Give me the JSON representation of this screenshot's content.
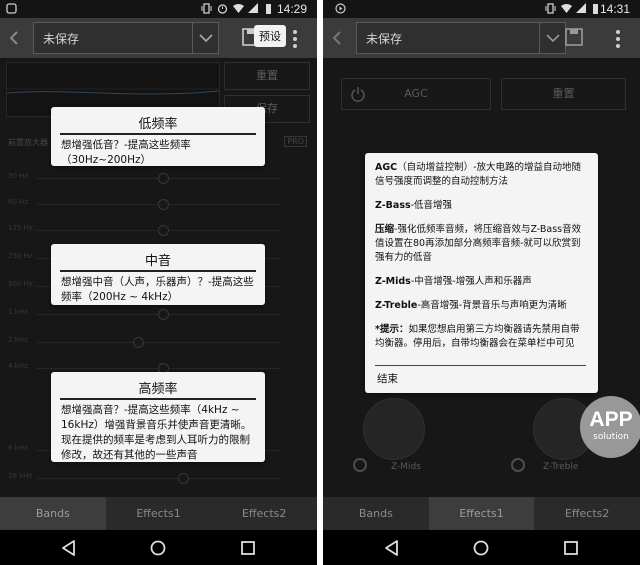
{
  "left": {
    "status_time": "14:29",
    "preset_value": "未保存",
    "tooltip": "预设",
    "buttons": {
      "reset": "重置",
      "save": "保存"
    },
    "mini_label": "前置放大器",
    "pro_tag": "PRO",
    "band_labels": [
      "30 Hz",
      "60 Hz",
      "125 Hz",
      "250 Hz",
      "500 Hz",
      "1 kHz",
      "2 kHz",
      "4 kHz",
      "8 kHz",
      "16 kHz"
    ],
    "popups": [
      {
        "title": "低频率",
        "body": "想增强低音？-提高这些频率（30Hz~200Hz）"
      },
      {
        "title": "中音",
        "body": "想增强中音（人声，乐器声）？-提高这些频率（200Hz ~ 4kHz）"
      },
      {
        "title": "高频率",
        "body": "想增强高音？-提高这些频率（4kHz ~ 16kHz）增强背景音乐并使声音更清晰。现在提供的频率是考虑到人耳听力的限制修改，故还有其他的一些声音"
      }
    ],
    "tabs": [
      "Bands",
      "Effects1",
      "Effects2"
    ],
    "active_tab": 0
  },
  "right": {
    "status_time": "14:31",
    "preset_value": "未保存",
    "agc_label": "AGC",
    "reset_label": "重置",
    "knob_labels": [
      "Z-Mids",
      "Z-Treble"
    ],
    "help": {
      "agc_term": "AGC",
      "agc_desc": "（自动增益控制）-放大电路的增益自动地随信号强度而调整的自动控制方法",
      "bass_term": "Z-Bass",
      "bass_desc": "-低音增强",
      "comp_term": "压缩",
      "comp_desc": "-强化低频率音频，将压缩音效与Z-Bass音效值设置在80再添加部分高频率音频-就可以欣赏到强有力的低音",
      "mids_term": "Z-Mids",
      "mids_desc": "-中音增强-增强人声和乐器声",
      "treble_term": "Z-Treble",
      "treble_desc": "-高音增强-背景音乐与声响更为清晰",
      "tip_term": "*提示：",
      "tip_desc": "如果您想启用第三方均衡器请先禁用自带均衡器。停用后，自带均衡器会在菜单栏中可见",
      "close": "结束"
    },
    "tabs": [
      "Bands",
      "Effects1",
      "Effects2"
    ],
    "active_tab": 1
  },
  "watermark": {
    "line1": "APP",
    "line2": "solution"
  },
  "colors": {
    "popup_bg": "#f4f4f4",
    "app_bg": "#242424",
    "toolbar": "#3b3b3b",
    "active_tab": "#3d3d3d"
  }
}
